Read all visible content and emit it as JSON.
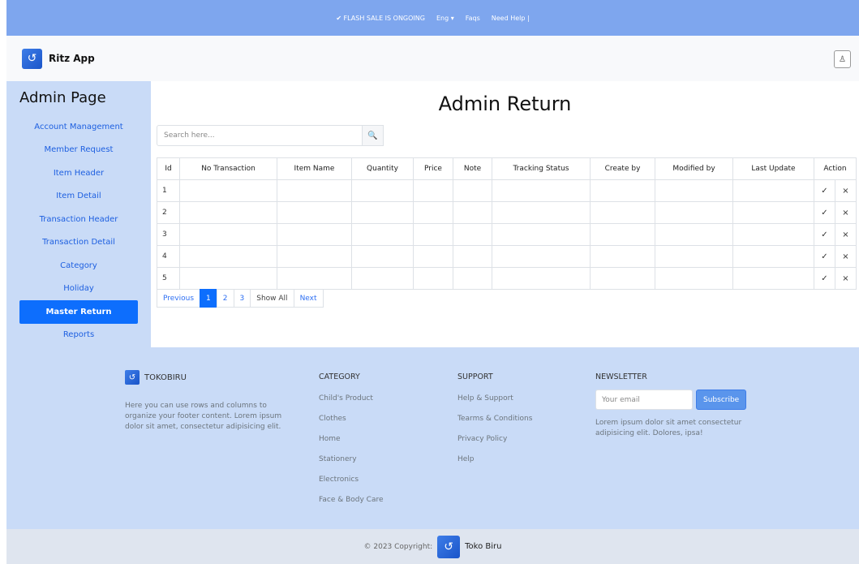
{
  "promo": {
    "flash": "✔ FLASH SALE IS ONGOING",
    "lang": "Eng ▾",
    "faqs": "Faqs",
    "help": "Need Help |"
  },
  "header": {
    "app_name": "Ritz App",
    "logo_glyph": "↺",
    "user_glyph": "♙"
  },
  "sidebar": {
    "title": "Admin Page",
    "items": [
      {
        "label": "Account Management"
      },
      {
        "label": "Member Request"
      },
      {
        "label": "Item Header"
      },
      {
        "label": "Item Detail"
      },
      {
        "label": "Transaction Header"
      },
      {
        "label": "Transaction Detail"
      },
      {
        "label": "Category"
      },
      {
        "label": "Holiday"
      },
      {
        "label": "Master Return"
      },
      {
        "label": "Reports"
      }
    ],
    "active_index": 8
  },
  "main": {
    "title": "Admin Return",
    "search": {
      "placeholder": "Search here...",
      "icon": "🔍"
    },
    "table": {
      "columns": [
        "Id",
        "No Transaction",
        "Item Name",
        "Quantity",
        "Price",
        "Note",
        "Tracking Status",
        "Create by",
        "Modified by",
        "Last Update",
        "Action"
      ],
      "rows": [
        {
          "id": "1",
          "approve": "✓",
          "reject": "×"
        },
        {
          "id": "2",
          "approve": "✓",
          "reject": "×"
        },
        {
          "id": "3",
          "approve": "✓",
          "reject": "×"
        },
        {
          "id": "4",
          "approve": "✓",
          "reject": "×"
        },
        {
          "id": "5",
          "approve": "✓",
          "reject": "×"
        }
      ]
    },
    "pagination": {
      "previous": "Previous",
      "pages": [
        "1",
        "2",
        "3"
      ],
      "current": "1",
      "show_all": "Show All",
      "next": "Next"
    }
  },
  "footer": {
    "brand": "TOKOBIRU",
    "description": "Here you can use rows and columns to organize your footer content. Lorem ipsum dolor sit amet, consectetur adipisicing elit.",
    "category": {
      "heading": "CATEGORY",
      "links": [
        "Child's Product",
        "Clothes",
        "Home",
        "Stationery",
        "Electronics",
        "Face & Body Care"
      ]
    },
    "support": {
      "heading": "SUPPORT",
      "links": [
        "Help & Support",
        "Tearms & Conditions",
        "Privacy Policy",
        "Help"
      ]
    },
    "newsletter": {
      "heading": "NEWSLETTER",
      "placeholder": "Your email",
      "button": "Subscribe",
      "description": "Lorem ipsum dolor sit amet consectetur adipisicing elit. Dolores, ipsa!"
    }
  },
  "copyright": {
    "text": "© 2023 Copyright:",
    "name": "Toko Biru"
  },
  "colors": {
    "accent": "#0d6efd",
    "promo": "#7ea6ee",
    "sidebar": "#c9dbf7"
  }
}
